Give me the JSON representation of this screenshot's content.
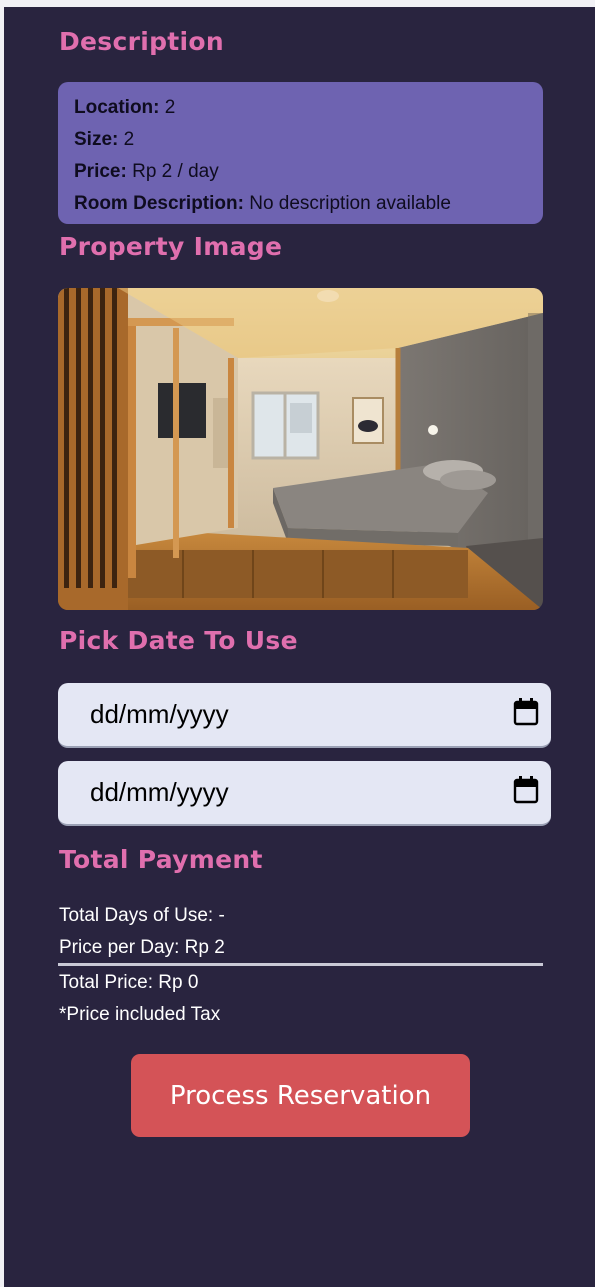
{
  "description": {
    "title": "Description",
    "location_label": "Location:",
    "location_value": "2",
    "size_label": "Size:",
    "size_value": "2",
    "price_label": "Price:",
    "price_value": "Rp 2 / day",
    "room_desc_label": "Room Description:",
    "room_desc_value": "No description available"
  },
  "property_image": {
    "title": "Property Image"
  },
  "date_picker": {
    "title": "Pick Date To Use",
    "start_value": "dd/mm/yyyy",
    "end_value": "dd/mm/yyyy",
    "icon": "calendar-icon"
  },
  "payment": {
    "title": "Total Payment",
    "total_days": "Total Days of Use: -",
    "price_per_day": "Price per Day: Rp 2",
    "total_price": "Total Price: Rp 0",
    "tax_note": "*Price included Tax"
  },
  "action": {
    "process_label": "Process Reservation"
  },
  "colors": {
    "background": "#29243f",
    "heading": "#e06fae",
    "description_box": "#6e63b1",
    "button": "#d45357"
  }
}
